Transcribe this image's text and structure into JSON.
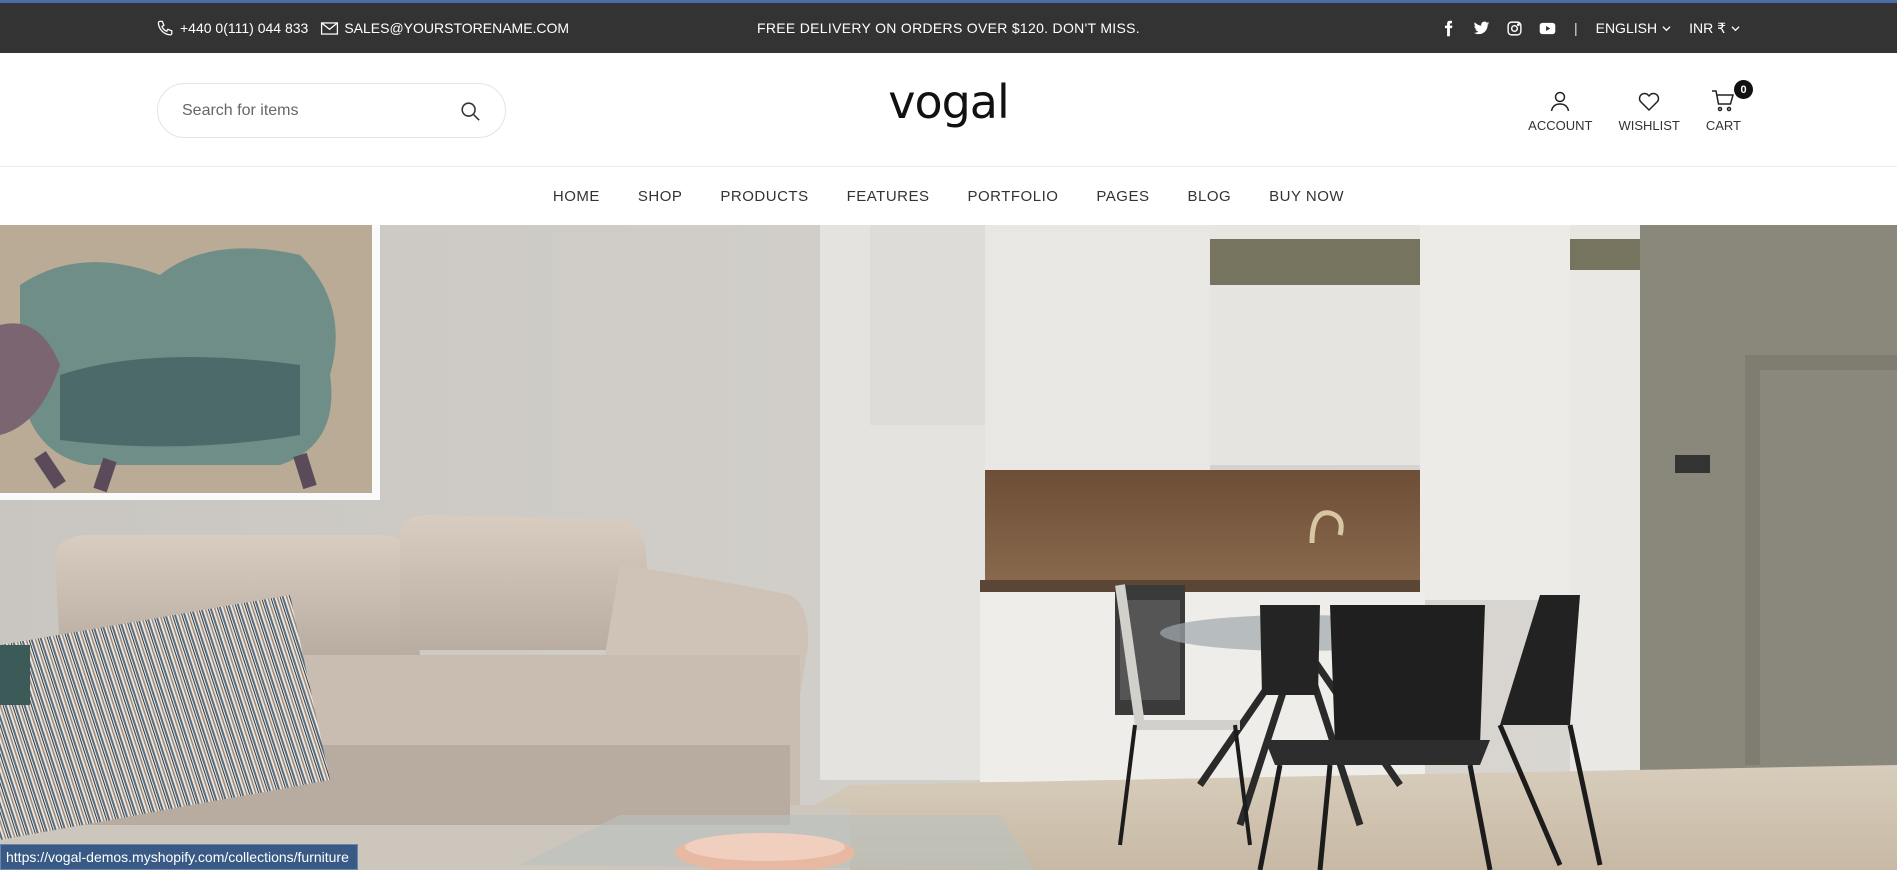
{
  "colors": {
    "accent_line": "#4a6da7",
    "topbar_bg": "#333333",
    "status_bg": "#3a5a86"
  },
  "topbar": {
    "phone": "+440 0(111) 044 833",
    "email": "SALES@YOURSTORENAME.COM",
    "announcement": "FREE DELIVERY ON ORDERS OVER $120. DON'T MISS.",
    "social_icons": [
      "facebook-icon",
      "twitter-icon",
      "instagram-icon",
      "youtube-icon"
    ],
    "separator": "|",
    "language": "ENGLISH",
    "currency": "INR ₹"
  },
  "header": {
    "search_placeholder": "Search for items",
    "logo": "vogal",
    "account_label": "ACCOUNT",
    "wishlist_label": "WISHLIST",
    "cart_label": "CART",
    "cart_count": "0"
  },
  "nav": {
    "items": [
      "HOME",
      "SHOP",
      "PRODUCTS",
      "FEATURES",
      "PORTFOLIO",
      "PAGES",
      "BLOG",
      "BUY NOW"
    ]
  },
  "status_bar": {
    "url": "https://vogal-demos.myshopify.com/collections/furniture"
  }
}
